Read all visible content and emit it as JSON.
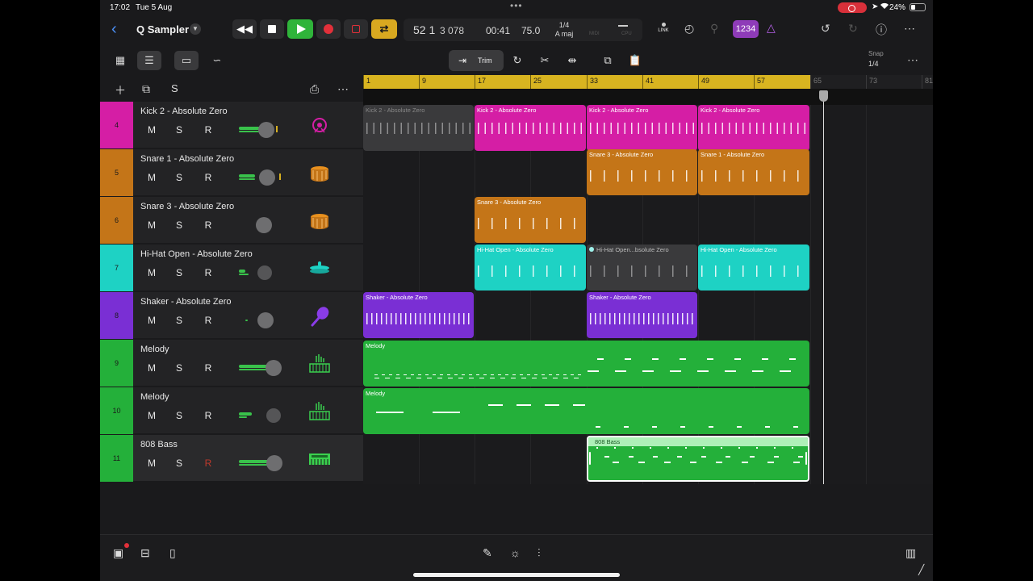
{
  "status": {
    "time": "17:02",
    "date": "Tue 5 Aug",
    "battery": "24%"
  },
  "header": {
    "title": "Q Sampler",
    "back_icon": "chevron-left-icon"
  },
  "transport": {
    "position": "52 1",
    "ticks": "3 078",
    "clock": "00:41",
    "tempo": "75.0",
    "signature": "1/4",
    "key": "A maj",
    "midi_label": "MIDI",
    "cpu_label": "CPU",
    "link_label": "LINK",
    "count_in": "1234"
  },
  "toolbar2": {
    "trim_label": "Trim",
    "snap_label": "Snap",
    "snap_value": "1/4"
  },
  "tracks": [
    {
      "number": "4",
      "name": "Kick 2 - Absolute Zero",
      "color": "#d51ea5",
      "instrument": "kick-drum-icon",
      "m": "M",
      "s": "S",
      "r": "R"
    },
    {
      "number": "5",
      "name": "Snare 1 - Absolute Zero",
      "color": "#c47518",
      "instrument": "snare-drum-icon",
      "m": "M",
      "s": "S",
      "r": "R"
    },
    {
      "number": "6",
      "name": "Snare 3 - Absolute Zero",
      "color": "#c47518",
      "instrument": "snare-drum-icon",
      "m": "M",
      "s": "S",
      "r": "R"
    },
    {
      "number": "7",
      "name": "Hi-Hat Open - Absolute Zero",
      "color": "#1ed2c4",
      "instrument": "hi-hat-icon",
      "m": "M",
      "s": "S",
      "r": "R"
    },
    {
      "number": "8",
      "name": "Shaker - Absolute Zero",
      "color": "#7a2fd4",
      "instrument": "shaker-icon",
      "m": "M",
      "s": "S",
      "r": "R"
    },
    {
      "number": "9",
      "name": "Melody",
      "color": "#24b03a",
      "instrument": "keyboard-icon",
      "m": "M",
      "s": "S",
      "r": "R"
    },
    {
      "number": "10",
      "name": "Melody",
      "color": "#24b03a",
      "instrument": "keyboard-icon",
      "m": "M",
      "s": "S",
      "r": "R"
    },
    {
      "number": "11",
      "name": "808 Bass",
      "color": "#24b03a",
      "instrument": "synth-icon",
      "m": "M",
      "s": "S",
      "r": "R"
    }
  ],
  "ruler": {
    "bars": [
      "1",
      "9",
      "17",
      "25",
      "33",
      "41",
      "49",
      "57",
      "65",
      "73",
      "81"
    ]
  },
  "regions": {
    "kick_a": "Kick 2 - Absolute Zero",
    "kick_b": "Kick 2 - Absolute Zero",
    "kick_c": "Kick 2 - Absolute Zero",
    "kick_d": "Kick 2 - Absolute Zero",
    "snare3_a": "Snare 3 - Absolute Zero",
    "snare1_b": "Snare 1 - Absolute Zero",
    "snare3_c": "Snare 3 - Absolute Zero",
    "hihat_a": "Hi-Hat Open - Absolute Zero",
    "hihat_b": "Hi-Hat Open...bsolute Zero",
    "hihat_c": "Hi-Hat Open - Absolute Zero",
    "shaker_a": "Shaker - Absolute Zero",
    "shaker_b": "Shaker - Absolute Zero",
    "melody_a": "Melody",
    "melody_b": "Melody",
    "bass": "808 Bass"
  },
  "track_header": {
    "solo_label": "S"
  }
}
